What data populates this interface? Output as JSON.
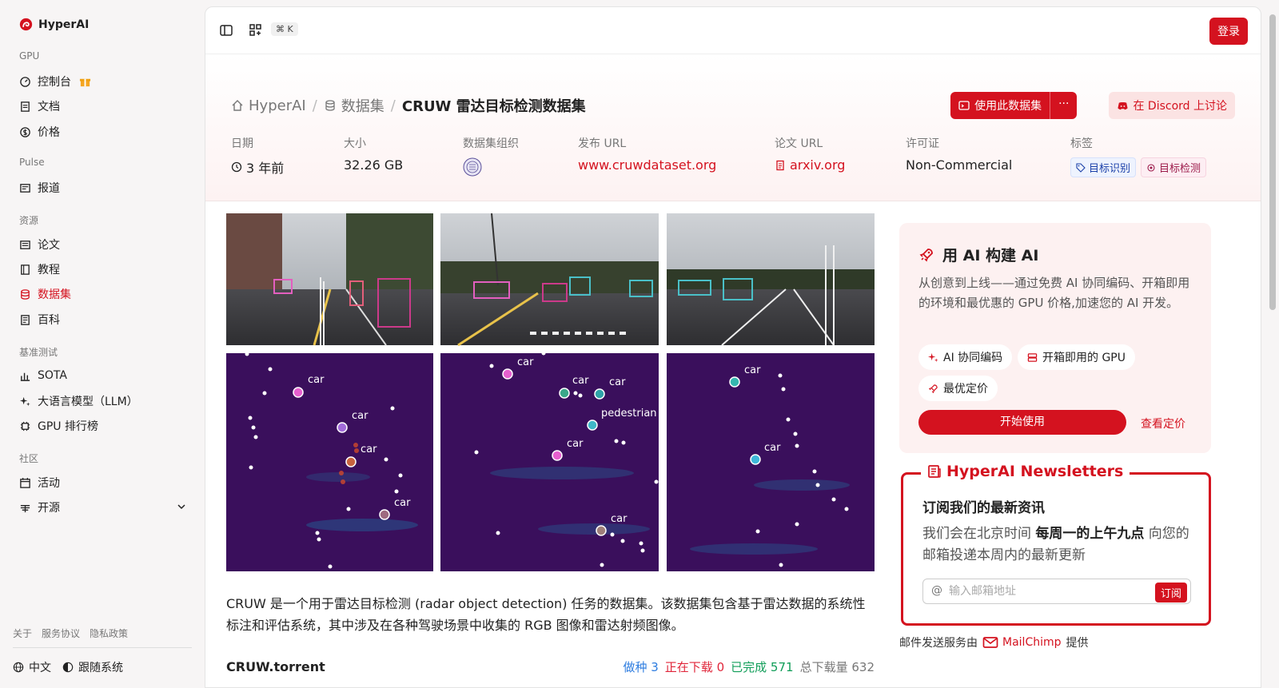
{
  "brand": {
    "name": "HyperAI"
  },
  "sidebar": {
    "sections": [
      {
        "label": "GPU",
        "items": [
          {
            "label": "控制台"
          },
          {
            "label": "文档"
          },
          {
            "label": "价格"
          }
        ]
      },
      {
        "label": "Pulse",
        "items": [
          {
            "label": "报道"
          }
        ]
      },
      {
        "label": "资源",
        "items": [
          {
            "label": "论文"
          },
          {
            "label": "教程"
          },
          {
            "label": "数据集"
          },
          {
            "label": "百科"
          }
        ]
      },
      {
        "label": "基准测试",
        "items": [
          {
            "label": "SOTA"
          },
          {
            "label": "大语言模型（LLM）"
          },
          {
            "label": "GPU 排行榜"
          }
        ]
      },
      {
        "label": "社区",
        "items": [
          {
            "label": "活动"
          },
          {
            "label": "开源"
          }
        ]
      }
    ],
    "active_item": "数据集",
    "footer_links": [
      "关于",
      "服务协议",
      "隐私政策"
    ],
    "language": "中文",
    "theme": "跟随系统"
  },
  "topbar": {
    "shortcut": "⌘ K",
    "login_label": "登录"
  },
  "breadcrumb": {
    "home": "HyperAI",
    "section": "数据集",
    "current": "CRUW 雷达目标检测数据集"
  },
  "actions": {
    "use_dataset": "使用此数据集",
    "more": "···",
    "discord": "在 Discord 上讨论"
  },
  "meta": {
    "date_label": "日期",
    "date_value": "3 年前",
    "size_label": "大小",
    "size_value": "32.26 GB",
    "org_label": "数据集组织",
    "publish_label": "发布 URL",
    "publish_value": "www.cruwdataset.org",
    "paper_label": "论文 URL",
    "paper_value": "arxiv.org",
    "license_label": "许可证",
    "license_value": "Non-Commercial",
    "tags_label": "标签",
    "tags": [
      "目标识别",
      "目标检测"
    ]
  },
  "figure": {
    "radar_labels": {
      "p1": [
        "car",
        "car",
        "car",
        "car"
      ],
      "p2": [
        "car",
        "car",
        "car",
        "pedestrian",
        "car",
        "car"
      ],
      "p3": [
        "car",
        "car"
      ]
    }
  },
  "description": "CRUW 是一个用于雷达目标检测 (radar object detection) 任务的数据集。该数据集包含基于雷达数据的系统性标注和评估系统，其中涉及在各种驾驶场景中收集的 RGB 图像和雷达射频图像。",
  "torrent": {
    "name": "CRUW.torrent",
    "seed_label": "做种",
    "seed": "3",
    "down_label": "正在下载",
    "down": "0",
    "done_label": "已完成",
    "done": "571",
    "total_label": "总下载量",
    "total": "632"
  },
  "ai_card": {
    "title": "用 AI 构建 AI",
    "text": "从创意到上线——通过免费 AI 协同编码、开箱即用的环境和最优惠的 GPU 价格,加速您的 AI 开发。",
    "chips": [
      "AI 协同编码",
      "开箱即用的 GPU",
      "最优定价"
    ],
    "start_label": "开始使用",
    "price_label": "查看定价"
  },
  "newsletter": {
    "title": "HyperAI Newsletters",
    "subtitle": "订阅我们的最新资讯",
    "text_before": "我们会在北京时间 ",
    "text_bold": "每周一的上午九点",
    "text_after": " 向您的邮箱投递本周内的最新更新",
    "email_placeholder": "输入邮箱地址",
    "subscribe_label": "订阅",
    "credit_before": "邮件发送服务由",
    "credit_brand": "MailChimp",
    "credit_after": "提供"
  },
  "colors": {
    "accent": "#d4121f",
    "radar_bg": "#3a0f5c"
  }
}
